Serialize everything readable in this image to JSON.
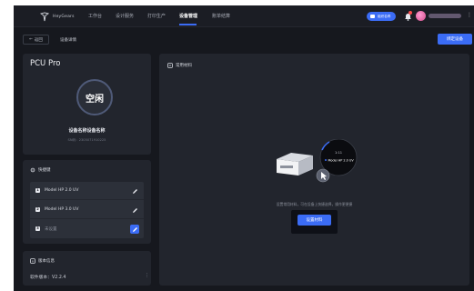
{
  "brand": {
    "logo_text": "HeyGears"
  },
  "nav": {
    "items": [
      "工作台",
      "设计服务",
      "打印生产",
      "设备管理",
      "账单结算"
    ],
    "active_index": 3
  },
  "header_right": {
    "pill_label": "组织名称"
  },
  "subheader": {
    "back_label": "返回",
    "breadcrumb": "设备详情",
    "bind_button": "绑定设备"
  },
  "device": {
    "model": "PCU Pro",
    "status": "空闲",
    "name": "设备名称设备名称",
    "sn": "SN码：2305071910225"
  },
  "quick": {
    "title": "快捷键",
    "items": [
      {
        "index": "1",
        "label": "Model HP 2.0 UV",
        "configured": true
      },
      {
        "index": "2",
        "label": "Model HP 3.0 UV",
        "configured": true
      },
      {
        "index": "3",
        "label": "未设置",
        "configured": false
      }
    ]
  },
  "version": {
    "title": "版本信息",
    "text": "软件版本：V2.2.4",
    "more": "⋮"
  },
  "materials": {
    "title": "常用材料",
    "illus_label": "Model HP 2.0 UV",
    "illus_time": "1:11",
    "empty_text": "设置常用材料，可在设备上快捷选择，操作更便捷",
    "setup_button": "设置材料"
  },
  "colors": {
    "accent": "#3b6cf5",
    "background": "#16181e",
    "card": "#22252d"
  },
  "icons": [
    "logo-icon",
    "bell-icon",
    "chevron-left-icon",
    "gear-icon",
    "edit-icon",
    "info-icon",
    "material-icon",
    "cursor-icon"
  ]
}
